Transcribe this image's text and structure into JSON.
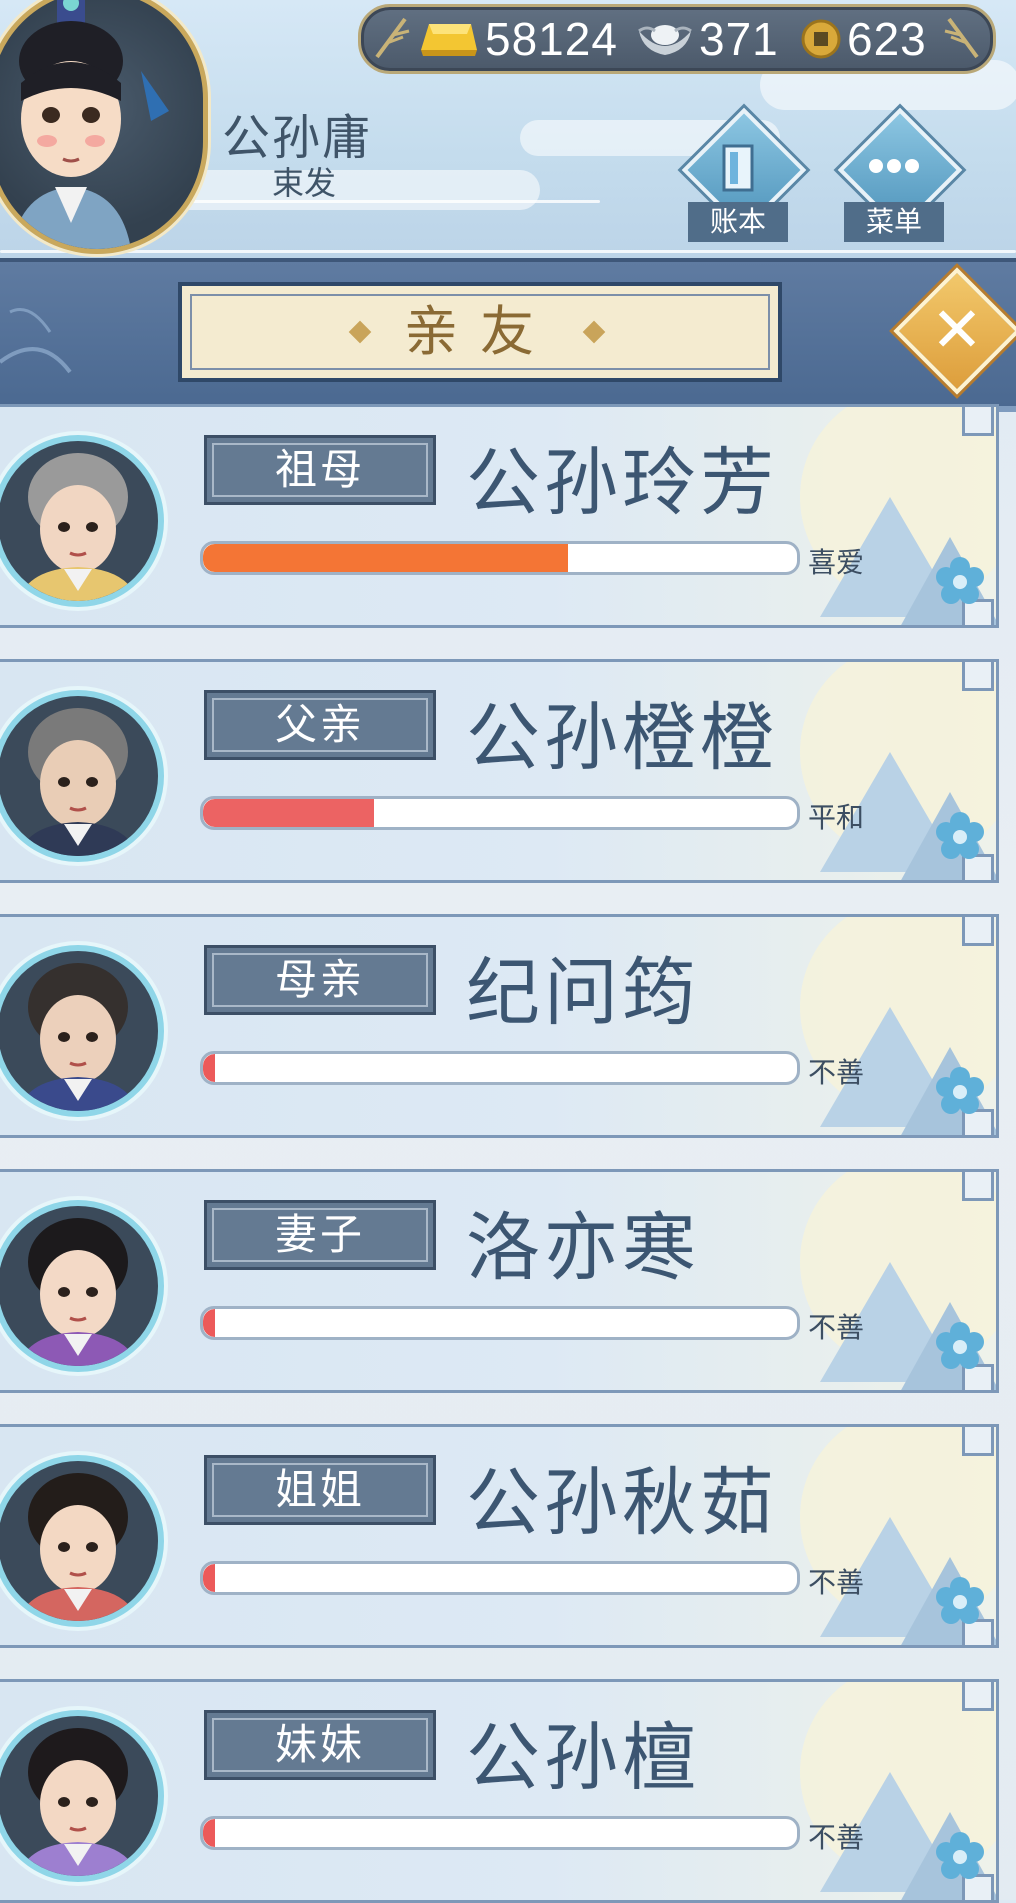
{
  "player": {
    "name": "公孙庸",
    "title": "束发"
  },
  "currency": {
    "gold": "58124",
    "silver": "371",
    "coins": "623"
  },
  "header_buttons": {
    "ledger_label": "账本",
    "menu_label": "菜单"
  },
  "panel": {
    "title": "亲友",
    "close_icon": "close-x-icon"
  },
  "relatives": [
    {
      "relation": "祖母",
      "name": "公孙玲芳",
      "mood": "喜爱",
      "affection": 0.62,
      "bar_color": "#f47535"
    },
    {
      "relation": "父亲",
      "name": "公孙橙橙",
      "mood": "平和",
      "affection": 0.29,
      "bar_color": "#ec6363"
    },
    {
      "relation": "母亲",
      "name": "纪问筠",
      "mood": "不善",
      "affection": 0.02,
      "bar_color": "#ec5a5a"
    },
    {
      "relation": "妻子",
      "name": "洛亦寒",
      "mood": "不善",
      "affection": 0.02,
      "bar_color": "#ec5a5a"
    },
    {
      "relation": "姐姐",
      "name": "公孙秋茹",
      "mood": "不善",
      "affection": 0.02,
      "bar_color": "#ec5a5a"
    },
    {
      "relation": "妹妹",
      "name": "公孙檀",
      "mood": "不善",
      "affection": 0.02,
      "bar_color": "#ec5a5a"
    }
  ]
}
